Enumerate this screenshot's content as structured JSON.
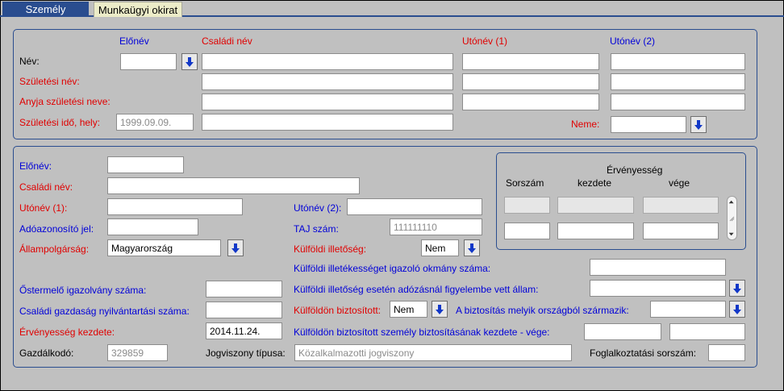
{
  "tabs": [
    {
      "label": "Személy"
    },
    {
      "label": "Munkaügyi okirat"
    }
  ],
  "name_section": {
    "headers": {
      "elonev": "Előnév",
      "csaladi_nev": "Családi név",
      "utonev1": "Utónév (1)",
      "utonev2": "Utónév (2)"
    },
    "rows": {
      "nev": "Név:",
      "szuletesi_nev": "Születési név:",
      "anyja_neve": "Anyja születési neve:",
      "szuletesi_ido": "Születési idő, hely:"
    },
    "birth_date": "1999.09.09.",
    "neme_label": "Neme:"
  },
  "person_section": {
    "elonev": "Előnév:",
    "csaladi_nev": "Családi név:",
    "utonev1": "Utónév (1):",
    "utonev2": "Utónév (2):",
    "adoazonosito": "Adóazonosító jel:",
    "taj_label": "TAJ szám:",
    "taj_value": "111111110",
    "allampolgarsag_label": "Állampolgárság:",
    "allampolgarsag_value": "Magyarország",
    "kulfoldi_illetoseg_label": "Külföldi illetőség:",
    "kulfoldi_illetoseg_value": "Nem",
    "igazolo_okmany": "Külföldi illetékességet igazoló okmány száma:",
    "ostermelo": "Őstermelő igazolvány száma:",
    "adozasnal_allam": "Külföldi illetőség esetén adózásnál figyelembe vett állam:",
    "csaladi_gazdasag": "Családi gazdaság nyilvántartási száma:",
    "kulfoldon_biztositott_label": "Külföldön biztosított:",
    "kulfoldon_biztositott_value": "Nem",
    "biztositas_orszag": "A biztosítás melyik országból származik:",
    "ervenyesseg_kezdete_label": "Érvényesség kezdete:",
    "ervenyesseg_kezdete_value": "2014.11.24.",
    "biztositas_kezdete_vege": "Külföldön biztosított személy biztosításának kezdete - vége:",
    "gazdalkodo_label": "Gazdálkodó:",
    "gazdalkodo_value": "329859",
    "jogviszony_label": "Jogviszony típusa:",
    "jogviszony_value": "Közalkalmazotti jogviszony",
    "foglalkoztatasi_label": "Foglalkoztatási sorszám:"
  },
  "validity_box": {
    "title": "Érvényesség",
    "sorszam": "Sorszám",
    "kezdete": "kezdete",
    "vege": "vége"
  },
  "colors": {
    "tab_active": "#2a4d8f",
    "label_red": "#e00000",
    "label_blue": "#0000d8",
    "background": "#c0c0c0"
  },
  "icons": {
    "dropdown_button": "blue-down-arrow-icon"
  }
}
